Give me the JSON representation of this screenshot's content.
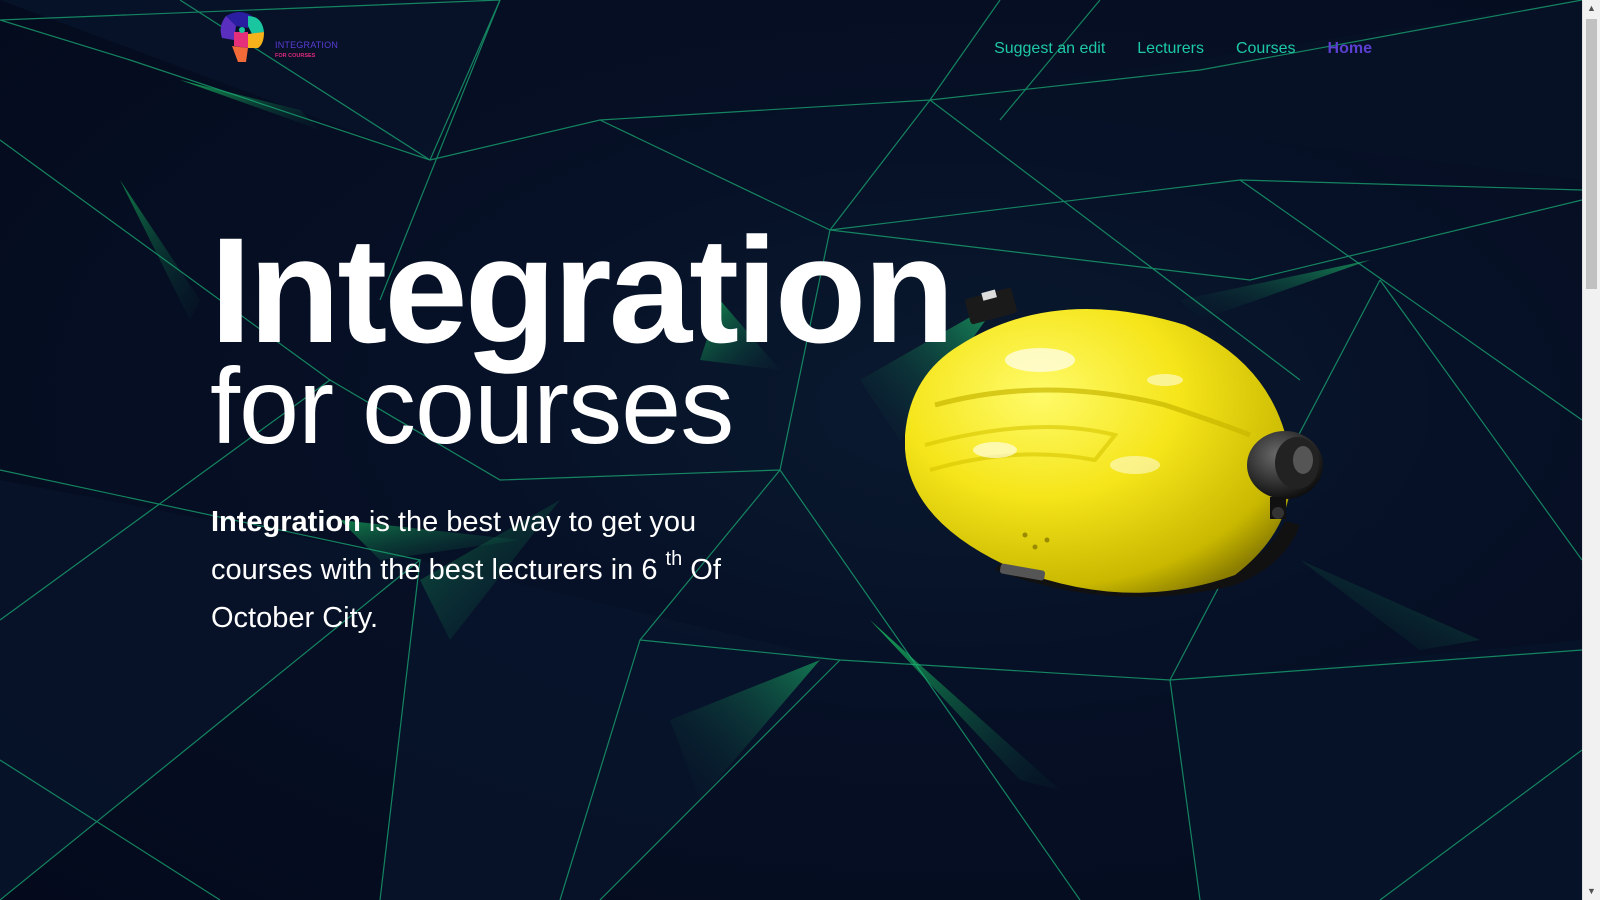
{
  "brand": {
    "logo_name": "integration-logo",
    "logo_main": "INTEGRATION",
    "logo_sub": "FOR COURSES"
  },
  "nav": {
    "items": [
      {
        "label": "Suggest an edit",
        "active": false
      },
      {
        "label": "Lecturers",
        "active": false
      },
      {
        "label": "Courses",
        "active": false
      },
      {
        "label": "Home",
        "active": true
      }
    ]
  },
  "hero": {
    "title": "Integration",
    "subtitle": "for courses",
    "desc_bold": "Integration",
    "desc_part1": " is the best way to get you courses with the best lecturers in 6 ",
    "desc_sup": "th",
    "desc_part2": " Of October City.",
    "image": "yellow-hard-hat"
  },
  "colors": {
    "background": "#050a1e",
    "nav_link": "#1ec9a7",
    "nav_active": "#5a3fd0",
    "accent_green": "#1bd96a",
    "helmet_yellow": "#f5e51a"
  }
}
